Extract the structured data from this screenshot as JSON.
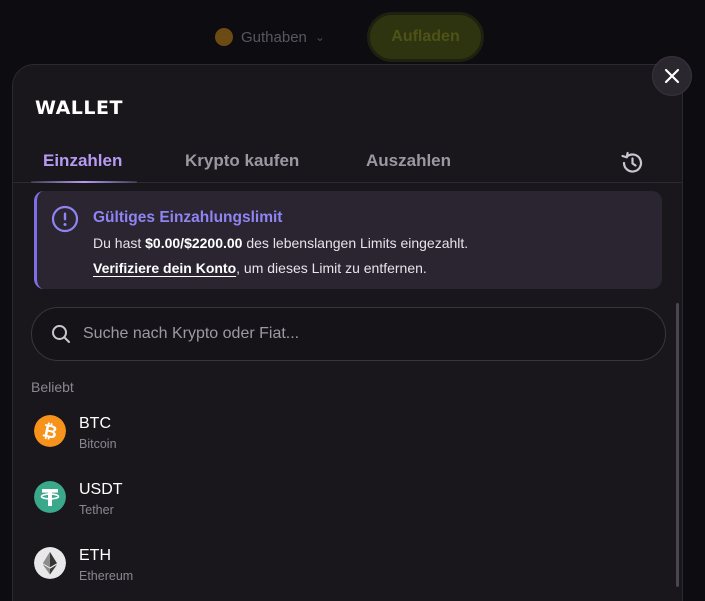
{
  "background": {
    "balance_text": "Guthaben",
    "topup_label": "Aufladen"
  },
  "modal": {
    "title": "WALLET",
    "close_icon": "close-icon",
    "tabs": [
      {
        "label": "Einzahlen",
        "active": true
      },
      {
        "label": "Krypto kaufen",
        "active": false
      },
      {
        "label": "Auszahlen",
        "active": false
      }
    ],
    "history_icon": "history-icon"
  },
  "alert": {
    "title": "Gültiges Einzahlungslimit",
    "line1_prefix": "Du hast ",
    "line1_amount": "$0.00/$2200.00",
    "line1_suffix": " des lebenslangen Limits eingezahlt.",
    "link_text": "Verifiziere dein Konto",
    "line2_suffix": ", um dieses Limit zu entfernen.",
    "accent_color": "#8f85f2"
  },
  "search": {
    "placeholder": "Suche nach Krypto oder Fiat..."
  },
  "popular": {
    "label": "Beliebt",
    "coins": [
      {
        "symbol": "BTC",
        "name": "Bitcoin",
        "icon": "bitcoin-icon",
        "color": "#f7931a"
      },
      {
        "symbol": "USDT",
        "name": "Tether",
        "icon": "tether-icon",
        "color": "#3aa88a"
      },
      {
        "symbol": "ETH",
        "name": "Ethereum",
        "icon": "ethereum-icon",
        "color": "#e8e8ea"
      }
    ]
  },
  "colors": {
    "active_tab": "#b79af2",
    "background": "#19171c"
  }
}
